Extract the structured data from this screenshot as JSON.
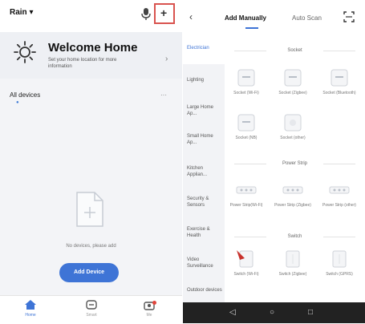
{
  "left": {
    "home_name": "Rain ▾",
    "welcome_title": "Welcome Home",
    "welcome_sub": "Set your home location for more information",
    "section_title": "All devices",
    "section_more": "···",
    "empty_text": "No devices, please add",
    "add_device": "Add Device",
    "nav": [
      {
        "label": "Home",
        "icon": "home-icon"
      },
      {
        "label": "Smart",
        "icon": "smart-icon"
      },
      {
        "label": "Me",
        "icon": "me-icon"
      }
    ]
  },
  "right": {
    "tabs": {
      "manual": "Add Manually",
      "auto": "Auto Scan"
    },
    "categories": [
      "Electrician",
      "Lighting",
      "Large Home Ap...",
      "Small Home Ap...",
      "Kitchen Applian...",
      "Security & Sensors",
      "Exercise & Health",
      "Video Surveillance",
      "Outdoor devices"
    ],
    "groups": [
      {
        "title": "Socket",
        "devices": [
          "Socket (Wi-Fi)",
          "Socket (Zigbee)",
          "Socket (Bluetooth)",
          "Socket (NB)",
          "Socket (other)"
        ]
      },
      {
        "title": "Power Strip",
        "devices": [
          "Power Strip(Wi-Fi)",
          "Power Strip (Zigbee)",
          "Power Strip (other)"
        ]
      },
      {
        "title": "Switch",
        "devices": [
          "Switch (Wi-Fi)",
          "Switch (Zigbee)",
          "Switch (GPRS)"
        ]
      }
    ]
  },
  "colors": {
    "accent": "#3e74d6",
    "highlight": "#d9534f"
  }
}
